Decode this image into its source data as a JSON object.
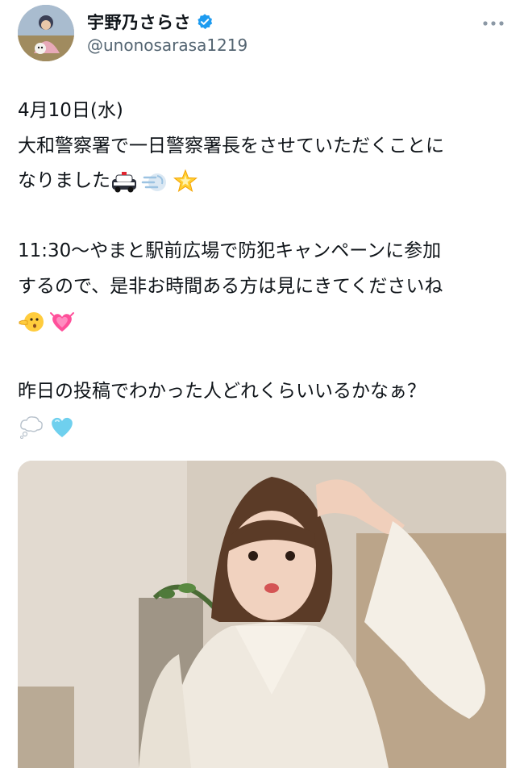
{
  "user": {
    "display_name": "宇野乃さらさ",
    "handle": "@unonosarasa1219",
    "avatar_icon": "avatar-photo",
    "verified_icon": "verified-badge-icon",
    "verified_color": "#1d9bf0"
  },
  "actions": {
    "more_icon": "more-options-icon"
  },
  "tweet": {
    "line1": "4月10日(水)",
    "line2": "大和警察署で一日警察署長をさせていただくことに",
    "line3": "なりました",
    "line3_emojis": [
      "police-car-emoji",
      "dash-emoji",
      "glowing-star-emoji"
    ],
    "line4": "11:30〜やまと駅前広場で防犯キャンペーンに参加",
    "line5": "するので、是非お時間ある方は見にきてくださいね",
    "line6_emojis": [
      "pointing-face-emoji",
      "growing-heart-emoji"
    ],
    "line7": "昨日の投稿でわかった人どれくらいいるかなぁ？",
    "line8_emojis": [
      "thought-balloon-emoji",
      "light-blue-heart-emoji"
    ]
  },
  "media": {
    "subject": "salute-photo"
  }
}
